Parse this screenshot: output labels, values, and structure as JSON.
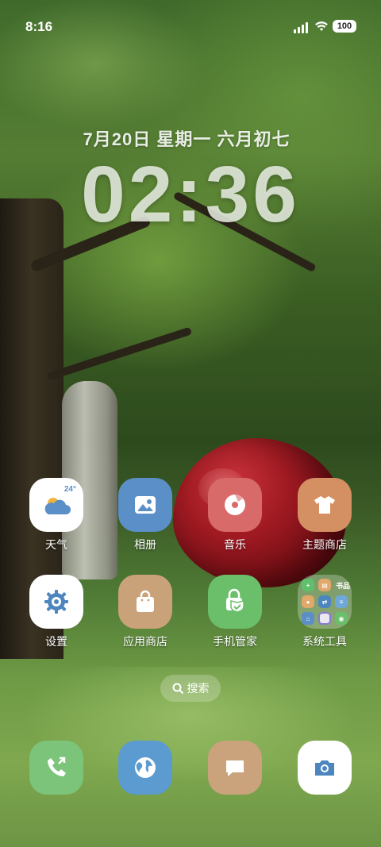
{
  "status_bar": {
    "time": "8:16",
    "battery": "100"
  },
  "lock_widget": {
    "date": "7月20日 星期一 六月初七",
    "time": "02:36"
  },
  "apps_row1": [
    {
      "label": "天气",
      "icon": "weather-icon",
      "temp": "24°"
    },
    {
      "label": "相册",
      "icon": "gallery-icon"
    },
    {
      "label": "音乐",
      "icon": "music-icon"
    },
    {
      "label": "主题商店",
      "icon": "theme-store-icon"
    }
  ],
  "apps_row2": [
    {
      "label": "设置",
      "icon": "settings-icon"
    },
    {
      "label": "应用商店",
      "icon": "app-store-icon"
    },
    {
      "label": "手机管家",
      "icon": "phone-manager-icon"
    },
    {
      "label": "系统工具",
      "icon": "system-tools-folder",
      "folder_badge": "书品"
    }
  ],
  "search": {
    "label": "搜索"
  },
  "dock": [
    {
      "icon": "phone-icon"
    },
    {
      "icon": "browser-icon"
    },
    {
      "icon": "messages-icon"
    },
    {
      "icon": "camera-icon"
    }
  ],
  "colors": {
    "weather": "#ffffff",
    "gallery": "#5b8fc7",
    "music": "#d96a6a",
    "theme_store": "#d48f62",
    "settings": "#ffffff",
    "app_store": "#c9a27a",
    "phone_manager": "#6cbf6a",
    "phone": "#7cc47a",
    "browser": "#5b9bd0",
    "messages": "#caa27c",
    "camera": "#ffffff"
  }
}
